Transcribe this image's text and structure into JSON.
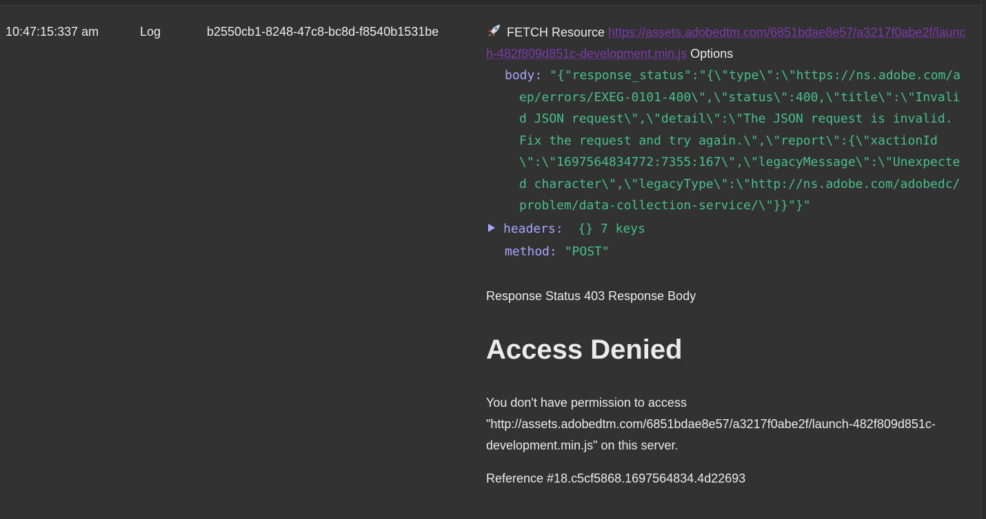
{
  "row": {
    "time": "10:47:15:337 am",
    "level": "Log",
    "id": "b2550cb1-8248-47c8-bc8d-f8540b1531be"
  },
  "message": {
    "icon": "rocket-icon",
    "prefix": "FETCH Resource",
    "url": "https://assets.adobedtm.com/6851bdae8e57/a3217f0abe2f/launch-482f809d851c-development.min.js",
    "suffix": "Options",
    "body_key": "body:",
    "body_value": "\"{\"response_status\":\"{\\\"type\\\":\\\"https://ns.adobe.com/aep/errors/EXEG-0101-400\\\",\\\"status\\\":400,\\\"title\\\":\\\"Invalid JSON request\\\",\\\"detail\\\":\\\"The JSON request is invalid. Fix the request and try again.\\\",\\\"report\\\":{\\\"xactionId\\\":\\\"1697564834772:7355:167\\\",\\\"legacyMessage\\\":\\\"Unexpected character\\\",\\\"legacyType\\\":\\\"http://ns.adobe.com/adobedc/problem/data-collection-service/\\\"}}\"}\"",
    "headers_key": "headers:",
    "headers_value": "{}  7 keys",
    "method_key": "method:",
    "method_value": "\"POST\"",
    "status_line": "Response Status 403 Response Body",
    "heading": "Access Denied",
    "permission": "You don't have permission to access \"http://assets.adobedtm.com/6851bdae8e57/a3217f0abe2f/launch-482f809d851c-development.min.js\" on this server.",
    "reference": "Reference #18.c5cf5868.1697564834.4d22693"
  },
  "colors": {
    "background": "#323232",
    "text": "#ebebeb",
    "json_key": "#a9a6ff",
    "json_string": "#46c08a",
    "link": "#7c3aa8"
  }
}
